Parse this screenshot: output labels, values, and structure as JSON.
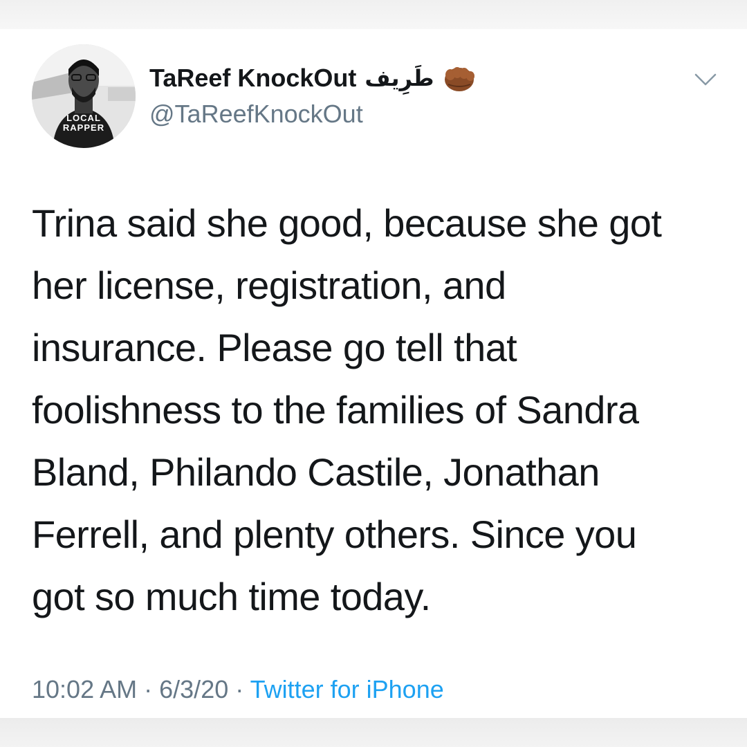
{
  "tweet": {
    "display_name": "TaReef KnockOut",
    "display_name_native": "طَرِيف",
    "handle": "@TaReefKnockOut",
    "avatar_shirt_text": [
      "LOCAL",
      "RAPPER"
    ],
    "text_lines": [
      "Trina said she good, because she got",
      "her license, registration, and",
      "insurance. Please go tell that",
      "foolishness to the families of Sandra",
      "Bland, Philando Castile, Jonathan",
      "Ferrell, and plenty others. Since you",
      "got so much time today."
    ],
    "time": "10:02 AM",
    "separator": "·",
    "date": "6/3/20",
    "source": "Twitter for iPhone"
  },
  "icons": {
    "emoji": "fist-icon",
    "menu": "chevron-down-icon"
  },
  "colors": {
    "text": "#14171a",
    "secondary": "#657786",
    "link": "#1da1f2"
  }
}
